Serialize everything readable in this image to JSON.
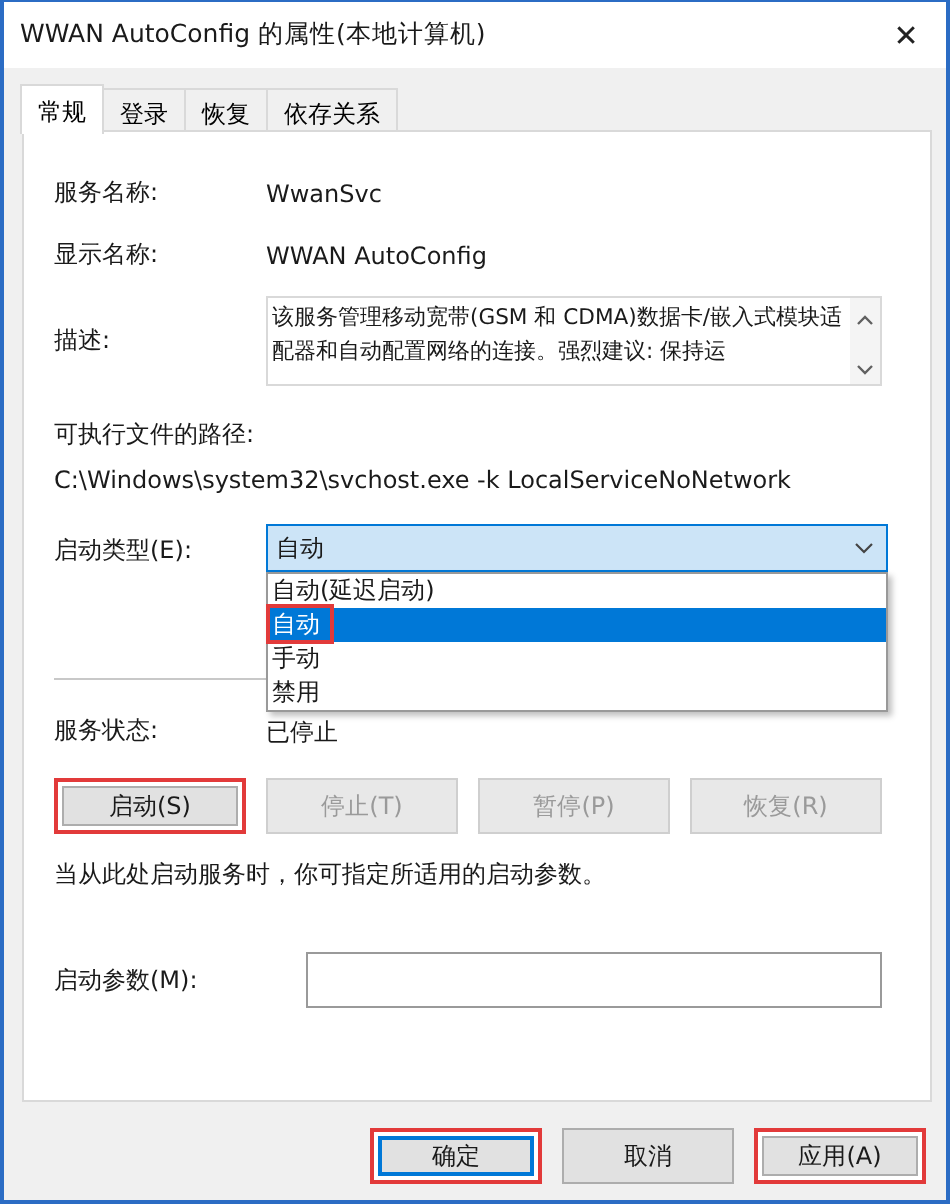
{
  "window": {
    "title": "WWAN AutoConfig 的属性(本地计算机)",
    "close": "✕"
  },
  "tabs": [
    {
      "label": "常规",
      "selected": true
    },
    {
      "label": "登录",
      "selected": false
    },
    {
      "label": "恢复",
      "selected": false
    },
    {
      "label": "依存关系",
      "selected": false
    }
  ],
  "service_name": {
    "label": "服务名称:",
    "value": "WwanSvc"
  },
  "display_name": {
    "label": "显示名称:",
    "value": "WWAN AutoConfig"
  },
  "description": {
    "label": "描述:",
    "value": "该服务管理移动宽带(GSM 和 CDMA)数据卡/嵌入式模块适配器和自动配置网络的连接。强烈建议: 保持运"
  },
  "path": {
    "label": "可执行文件的路径:",
    "value": "C:\\Windows\\system32\\svchost.exe -k LocalServiceNoNetwork"
  },
  "startup_type": {
    "label": "启动类型(E):",
    "value": "自动",
    "expanded": true,
    "options": [
      {
        "label": "自动(延迟启动)",
        "selected": false,
        "highlighted": false
      },
      {
        "label": "自动",
        "selected": true,
        "highlighted": true
      },
      {
        "label": "手动",
        "selected": false,
        "highlighted": false
      },
      {
        "label": "禁用",
        "selected": false,
        "highlighted": false
      }
    ]
  },
  "service_status": {
    "label": "服务状态:",
    "value": "已停止"
  },
  "service_buttons": [
    {
      "label": "启动(S)",
      "disabled": false,
      "highlighted": true
    },
    {
      "label": "停止(T)",
      "disabled": true,
      "highlighted": false
    },
    {
      "label": "暂停(P)",
      "disabled": true,
      "highlighted": false
    },
    {
      "label": "恢复(R)",
      "disabled": true,
      "highlighted": false
    }
  ],
  "hint": "当从此处启动服务时，你可指定所适用的启动参数。",
  "start_params": {
    "label": "启动参数(M):"
  },
  "dialog_buttons": [
    {
      "label": "确定",
      "default": true,
      "highlighted": true
    },
    {
      "label": "取消",
      "default": false,
      "highlighted": false
    },
    {
      "label": "应用(A)",
      "default": false,
      "highlighted": true
    }
  ]
}
